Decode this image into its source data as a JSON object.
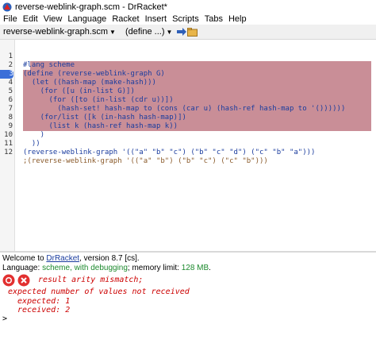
{
  "window": {
    "title": "reverse-weblink-graph.scm - DrRacket*"
  },
  "menu": [
    "File",
    "Edit",
    "View",
    "Language",
    "Racket",
    "Insert",
    "Scripts",
    "Tabs",
    "Help"
  ],
  "toolbar": {
    "file_name": "reverse-weblink-graph.scm",
    "define_label": "(define ...)"
  },
  "editor": {
    "line_numbers": [
      "1",
      "2",
      "3",
      "4",
      "5",
      "6",
      "7",
      "8",
      "9",
      "10",
      "11",
      "12"
    ],
    "current_line": "3",
    "lines": [
      "#lang scheme",
      "(define (reverse-weblink-graph G)",
      "  (let ((hash-map (make-hash)))",
      "    (for ([u (in-list G)])",
      "      (for ([to (in-list (cdr u))])",
      "        (hash-set! hash-map to (cons (car u) (hash-ref hash-map to '())))))",
      "    (for/list ([k (in-hash hash-map)])",
      "      (list k (hash-ref hash-map k))",
      "    )",
      "  ))",
      "(reverse-weblink-graph '((\"a\" \"b\" \"c\") (\"b\" \"c\" \"d\") (\"c\" \"b\" \"a\")))",
      ";(reverse-weblink-graph '((\"a\" \"b\") (\"b\" \"c\") (\"c\" \"b\")))"
    ]
  },
  "repl": {
    "welcome_prefix": "Welcome to ",
    "welcome_link": "DrRacket",
    "welcome_suffix": ", version 8.7 [cs].",
    "language_prefix": "Language: ",
    "language_name": "scheme, with debugging",
    "language_mid": "; memory limit: ",
    "memory_limit": "128 MB",
    "language_end": ".",
    "error_title": "result arity mismatch;",
    "error_line2": "expected number of values not received",
    "error_expected": "  expected: 1",
    "error_received": "  received: 2",
    "prompt": ">"
  },
  "colors": {
    "highlight": "#c98e97",
    "code": "#1a3c9e",
    "error": "#cc0000",
    "link": "#1a3c9e",
    "language": "#1d8a2e"
  }
}
